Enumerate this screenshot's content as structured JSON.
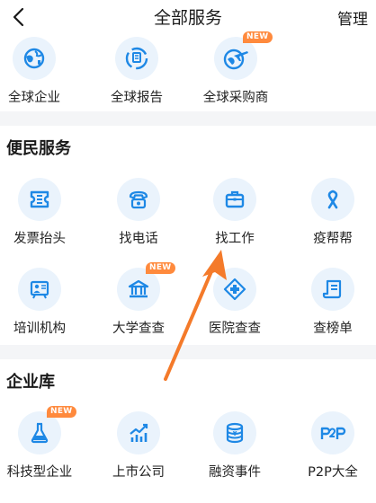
{
  "header": {
    "title": "全部服务",
    "manage_label": "管理"
  },
  "top_row": [
    {
      "label": "全球企业",
      "icon": "globe-pin-icon"
    },
    {
      "label": "全球报告",
      "icon": "globe-report-icon"
    },
    {
      "label": "全球采购商",
      "icon": "globe-plane-icon",
      "badge": "NEW"
    }
  ],
  "sections": [
    {
      "title": "便民服务",
      "items": [
        {
          "label": "发票抬头",
          "icon": "ticket-icon"
        },
        {
          "label": "找电话",
          "icon": "telephone-icon"
        },
        {
          "label": "找工作",
          "icon": "briefcase-icon"
        },
        {
          "label": "疫帮帮",
          "icon": "ribbon-icon"
        },
        {
          "label": "培训机构",
          "icon": "training-board-icon"
        },
        {
          "label": "大学查查",
          "icon": "university-icon",
          "badge": "NEW"
        },
        {
          "label": "医院查查",
          "icon": "hospital-cross-icon"
        },
        {
          "label": "查榜单",
          "icon": "scroll-list-icon"
        }
      ]
    },
    {
      "title": "企业库",
      "items": [
        {
          "label": "科技型企业",
          "icon": "flask-icon",
          "badge": "NEW"
        },
        {
          "label": "上市公司",
          "icon": "rising-chart-icon"
        },
        {
          "label": "融资事件",
          "icon": "coin-stack-icon"
        },
        {
          "label": "P2P大全",
          "icon": "p2p-icon"
        }
      ]
    }
  ],
  "colors": {
    "accent": "#1e88e5",
    "icon_bg": "#eaf3fc",
    "badge": "#ff8a3d",
    "arrow": "#f47a2a",
    "divider": "#f4f5f7"
  }
}
